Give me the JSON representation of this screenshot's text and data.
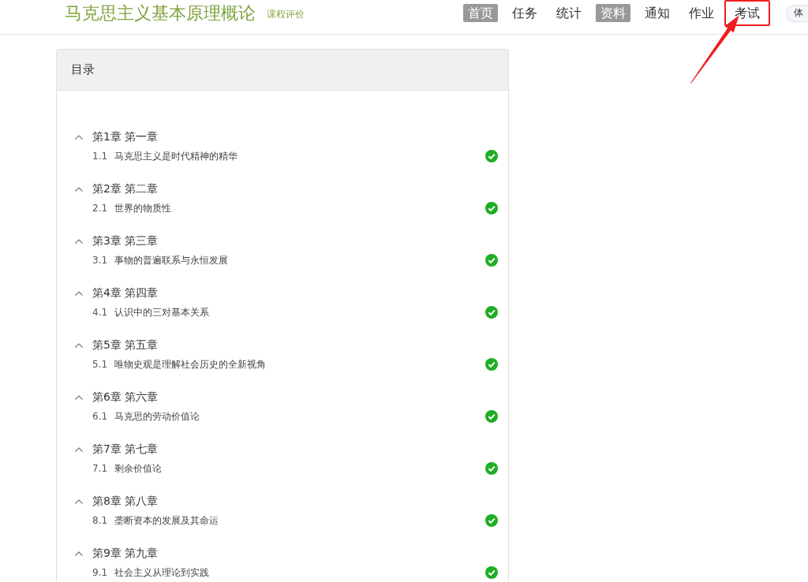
{
  "header": {
    "title": "马克思主义基本原理概论",
    "subtitle": "课程评价"
  },
  "nav": [
    {
      "label": "首页",
      "selected": true,
      "highlighted": false
    },
    {
      "label": "任务",
      "selected": false,
      "highlighted": false
    },
    {
      "label": "统计",
      "selected": false,
      "highlighted": false
    },
    {
      "label": "资料",
      "selected": true,
      "highlighted": false
    },
    {
      "label": "通知",
      "selected": false,
      "highlighted": false
    },
    {
      "label": "作业",
      "selected": false,
      "highlighted": false
    },
    {
      "label": "考试",
      "selected": false,
      "highlighted": true
    }
  ],
  "trial_button": {
    "label": "体"
  },
  "catalog": {
    "title": "目录",
    "chapters": [
      {
        "title": "第1章 第一章",
        "expanded": true,
        "sections": [
          {
            "number": "1.1",
            "title": "马克思主义是时代精神的精华",
            "completed": true
          }
        ]
      },
      {
        "title": "第2章 第二章",
        "expanded": true,
        "sections": [
          {
            "number": "2.1",
            "title": "世界的物质性",
            "completed": true
          }
        ]
      },
      {
        "title": "第3章 第三章",
        "expanded": true,
        "sections": [
          {
            "number": "3.1",
            "title": "事物的普遍联系与永恒发展",
            "completed": true
          }
        ]
      },
      {
        "title": "第4章 第四章",
        "expanded": true,
        "sections": [
          {
            "number": "4.1",
            "title": "认识中的三对基本关系",
            "completed": true
          }
        ]
      },
      {
        "title": "第5章 第五章",
        "expanded": true,
        "sections": [
          {
            "number": "5.1",
            "title": "唯物史观是理解社会历史的全新视角",
            "completed": true
          }
        ]
      },
      {
        "title": "第6章 第六章",
        "expanded": true,
        "sections": [
          {
            "number": "6.1",
            "title": "马克思的劳动价值论",
            "completed": true
          }
        ]
      },
      {
        "title": "第7章 第七章",
        "expanded": true,
        "sections": [
          {
            "number": "7.1",
            "title": "剩余价值论",
            "completed": true
          }
        ]
      },
      {
        "title": "第8章 第八章",
        "expanded": true,
        "sections": [
          {
            "number": "8.1",
            "title": "垄断资本的发展及其命运",
            "completed": true
          }
        ]
      },
      {
        "title": "第9章 第九章",
        "expanded": true,
        "sections": [
          {
            "number": "9.1",
            "title": "社会主义从理论到实践",
            "completed": true
          }
        ]
      }
    ]
  }
}
